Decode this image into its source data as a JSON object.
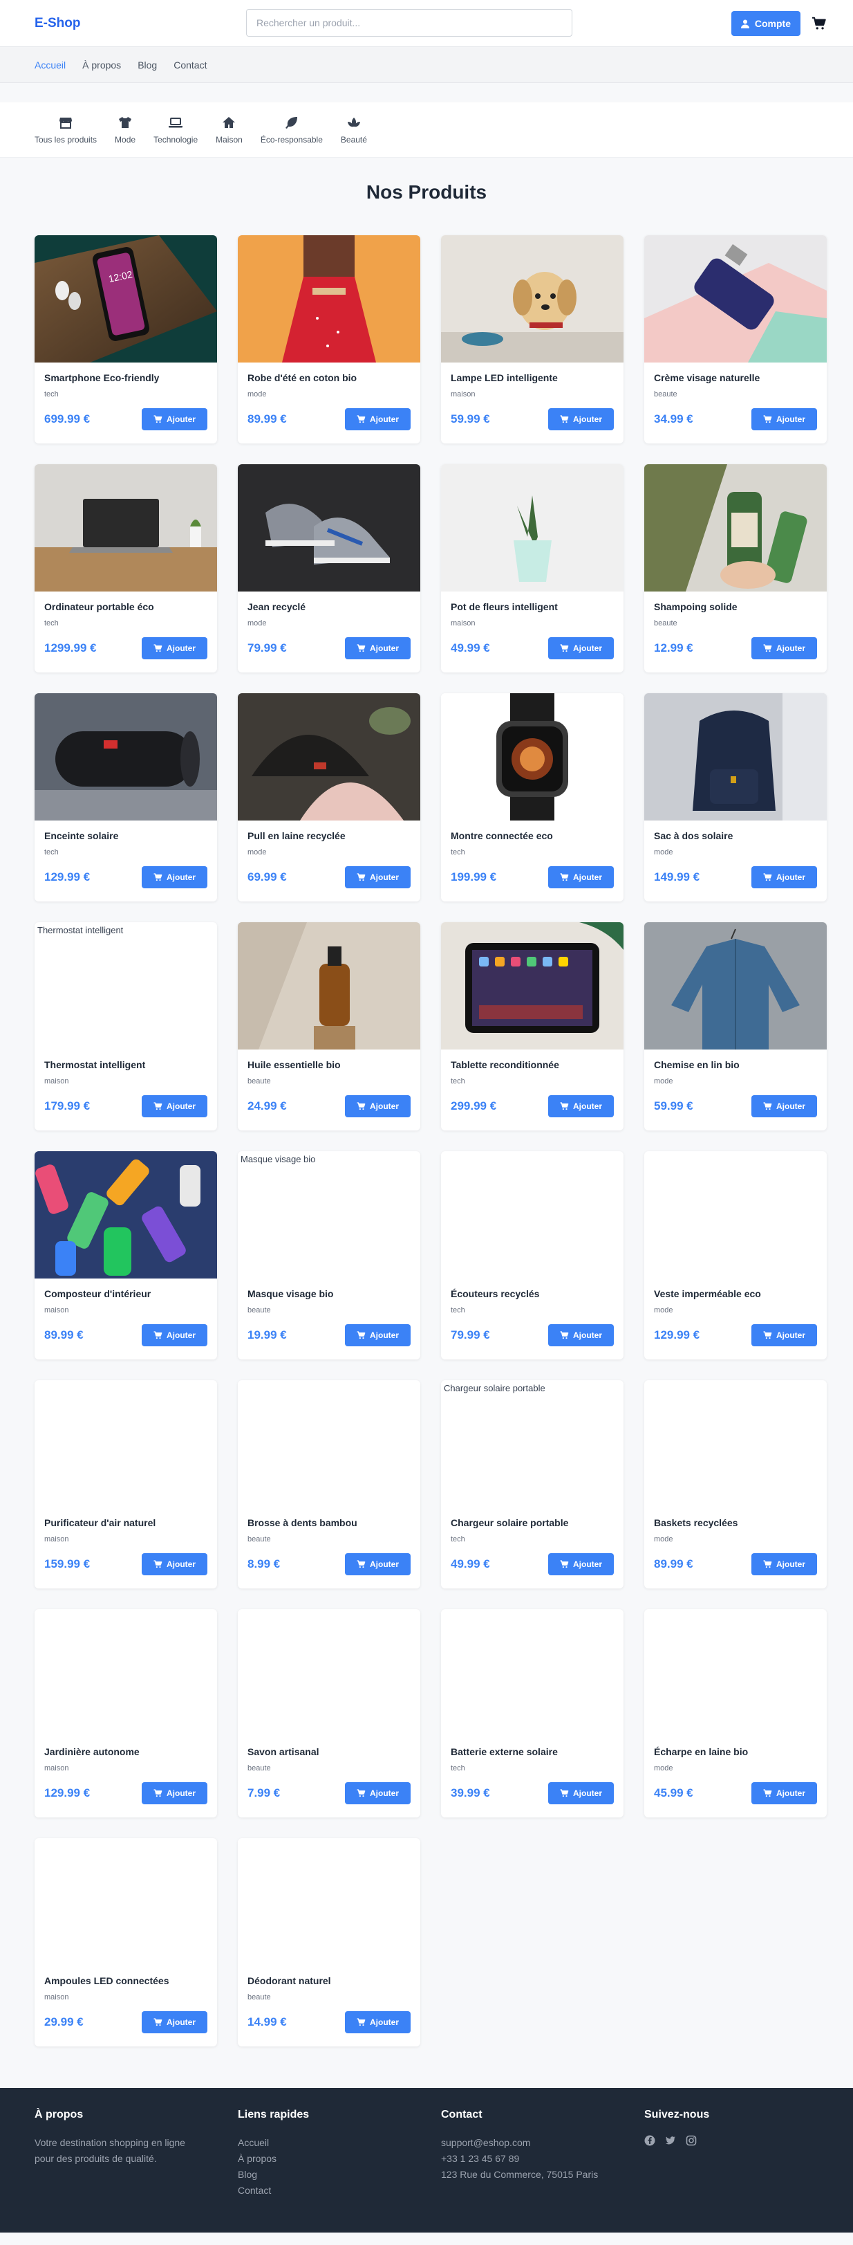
{
  "header": {
    "logo": "E-Shop",
    "search_placeholder": "Rechercher un produit...",
    "account_label": "Compte"
  },
  "nav": {
    "items": [
      "Accueil",
      "À propos",
      "Blog",
      "Contact"
    ]
  },
  "categories": [
    {
      "label": "Tous les produits",
      "icon": "store-icon"
    },
    {
      "label": "Mode",
      "icon": "shirt-icon"
    },
    {
      "label": "Technologie",
      "icon": "laptop-icon"
    },
    {
      "label": "Maison",
      "icon": "home-icon"
    },
    {
      "label": "Éco-responsable",
      "icon": "leaf-icon"
    },
    {
      "label": "Beauté",
      "icon": "spa-icon"
    }
  ],
  "products_title": "Nos Produits",
  "add_label": "Ajouter",
  "products": [
    {
      "name": "Smartphone Eco-friendly",
      "category": "tech",
      "price": "699.99 €",
      "image": "photo-smartphone"
    },
    {
      "name": "Robe d'été en coton bio",
      "category": "mode",
      "price": "89.99 €",
      "image": "photo-dress"
    },
    {
      "name": "Lampe LED intelligente",
      "category": "maison",
      "price": "59.99 €",
      "image": "photo-puppy"
    },
    {
      "name": "Crème visage naturelle",
      "category": "beaute",
      "price": "34.99 €",
      "image": "photo-cream"
    },
    {
      "name": "Ordinateur portable éco",
      "category": "tech",
      "price": "1299.99 €",
      "image": "photo-laptop"
    },
    {
      "name": "Jean recyclé",
      "category": "mode",
      "price": "79.99 €",
      "image": "photo-sneakers"
    },
    {
      "name": "Pot de fleurs intelligent",
      "category": "maison",
      "price": "49.99 €",
      "image": "photo-plant"
    },
    {
      "name": "Shampoing solide",
      "category": "beaute",
      "price": "12.99 €",
      "image": "photo-bottles"
    },
    {
      "name": "Enceinte solaire",
      "category": "tech",
      "price": "129.99 €",
      "image": "photo-speaker"
    },
    {
      "name": "Pull en laine recyclée",
      "category": "mode",
      "price": "69.99 €",
      "image": "photo-beanies"
    },
    {
      "name": "Montre connectée eco",
      "category": "tech",
      "price": "199.99 €",
      "image": "photo-watch"
    },
    {
      "name": "Sac à dos solaire",
      "category": "mode",
      "price": "149.99 €",
      "image": "photo-backpack"
    },
    {
      "name": "Thermostat intelligent",
      "category": "maison",
      "price": "179.99 €",
      "image": "",
      "alt": "Thermostat intelligent"
    },
    {
      "name": "Huile essentielle bio",
      "category": "beaute",
      "price": "24.99 €",
      "image": "photo-oil"
    },
    {
      "name": "Tablette reconditionnée",
      "category": "tech",
      "price": "299.99 €",
      "image": "photo-tablet"
    },
    {
      "name": "Chemise en lin bio",
      "category": "mode",
      "price": "59.99 €",
      "image": "photo-shirt"
    },
    {
      "name": "Composteur d'intérieur",
      "category": "maison",
      "price": "89.99 €",
      "image": "photo-bottles-colorful"
    },
    {
      "name": "Masque visage bio",
      "category": "beaute",
      "price": "19.99 €",
      "image": "",
      "alt": "Masque visage bio"
    },
    {
      "name": "Écouteurs recyclés",
      "category": "tech",
      "price": "79.99 €",
      "image": ""
    },
    {
      "name": "Veste imperméable eco",
      "category": "mode",
      "price": "129.99 €",
      "image": ""
    },
    {
      "name": "Purificateur d'air naturel",
      "category": "maison",
      "price": "159.99 €",
      "image": ""
    },
    {
      "name": "Brosse à dents bambou",
      "category": "beaute",
      "price": "8.99 €",
      "image": ""
    },
    {
      "name": "Chargeur solaire portable",
      "category": "tech",
      "price": "49.99 €",
      "image": "",
      "alt": "Chargeur solaire portable"
    },
    {
      "name": "Baskets recyclées",
      "category": "mode",
      "price": "89.99 €",
      "image": ""
    },
    {
      "name": "Jardinière autonome",
      "category": "maison",
      "price": "129.99 €",
      "image": ""
    },
    {
      "name": "Savon artisanal",
      "category": "beaute",
      "price": "7.99 €",
      "image": ""
    },
    {
      "name": "Batterie externe solaire",
      "category": "tech",
      "price": "39.99 €",
      "image": ""
    },
    {
      "name": "Écharpe en laine bio",
      "category": "mode",
      "price": "45.99 €",
      "image": ""
    },
    {
      "name": "Ampoules LED connectées",
      "category": "maison",
      "price": "29.99 €",
      "image": ""
    },
    {
      "name": "Déodorant naturel",
      "category": "beaute",
      "price": "14.99 €",
      "image": ""
    }
  ],
  "footer": {
    "about_title": "À propos",
    "about_text": "Votre destination shopping en ligne pour des produits de qualité.",
    "links_title": "Liens rapides",
    "links": [
      "Accueil",
      "À propos",
      "Blog",
      "Contact"
    ],
    "contact_title": "Contact",
    "email": "support@eshop.com",
    "phone": "+33 1 23 45 67 89",
    "address": "123 Rue du Commerce, 75015 Paris",
    "follow_title": "Suivez-nous",
    "social": [
      "facebook-icon",
      "twitter-icon",
      "instagram-icon"
    ]
  },
  "colors": {
    "accent": "#3b82f6",
    "footer_bg": "#1f2937",
    "page_bg": "#f7f8fa"
  }
}
